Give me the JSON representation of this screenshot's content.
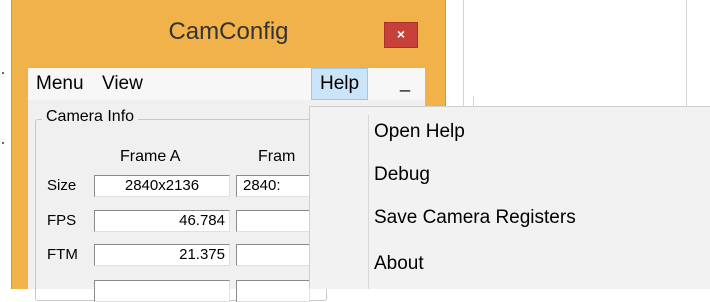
{
  "window": {
    "title": "CamConfig",
    "close_glyph": "×",
    "minimize_glyph": "_"
  },
  "menubar": {
    "items": [
      {
        "label": "Menu"
      },
      {
        "label": "View"
      },
      {
        "label": "Help"
      }
    ]
  },
  "camera_info": {
    "legend": "Camera Info",
    "columns": [
      "Frame A",
      "Fram"
    ],
    "rows": [
      {
        "label": "Size",
        "a": "2840x2136",
        "b": "2840:"
      },
      {
        "label": "FPS",
        "a": "46.784",
        "b": ""
      },
      {
        "label": "FTM",
        "a": "21.375",
        "b": ""
      }
    ]
  },
  "help_menu": {
    "items": [
      {
        "label": "Open Help"
      },
      {
        "label": "Debug"
      },
      {
        "label": "Save Camera Registers"
      },
      {
        "label": "About"
      }
    ]
  },
  "colors": {
    "frame": "#f2b24a",
    "close": "#c7413a",
    "menu_highlight": "#cce4f7"
  }
}
